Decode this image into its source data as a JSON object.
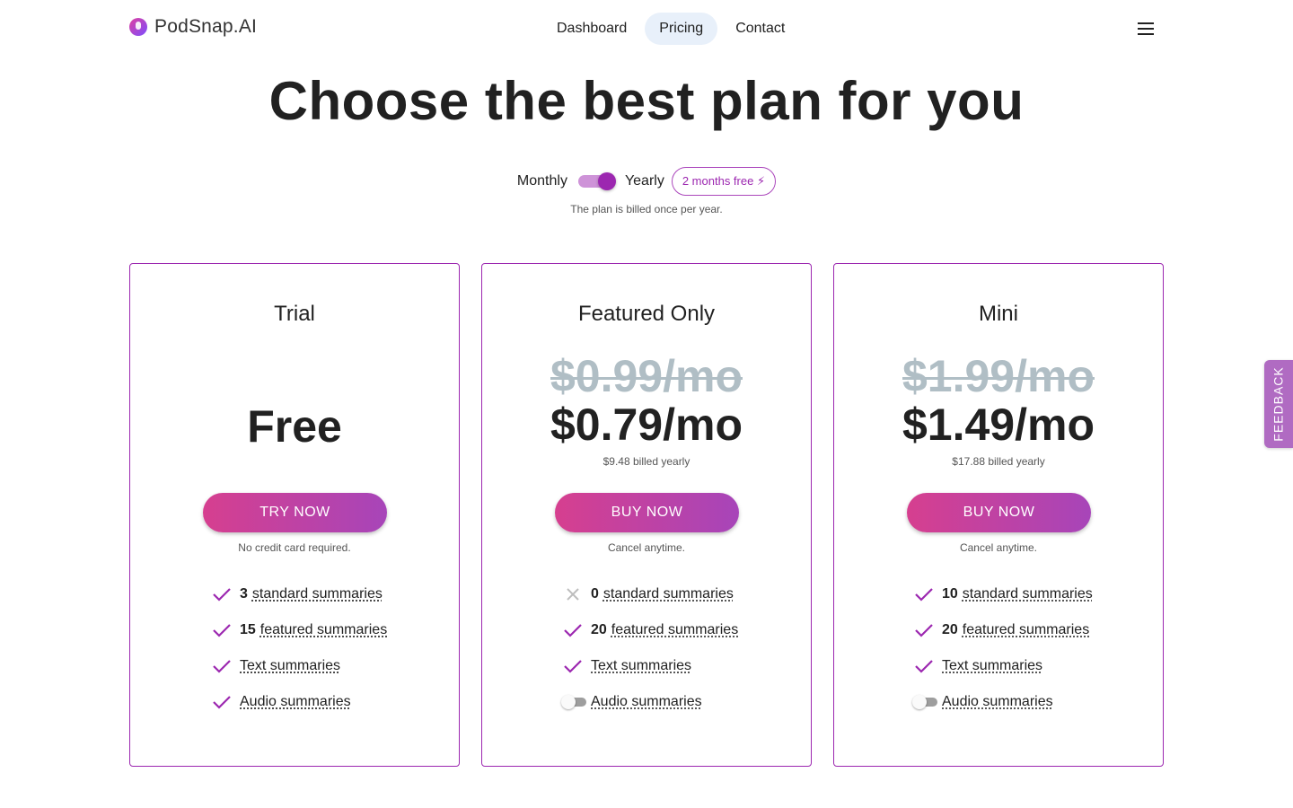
{
  "brand": {
    "name": "PodSnap.AI"
  },
  "nav": [
    {
      "label": "Dashboard",
      "active": false
    },
    {
      "label": "Pricing",
      "active": true
    },
    {
      "label": "Contact",
      "active": false
    }
  ],
  "hero": {
    "title": "Choose the best plan for you",
    "monthly_label": "Monthly",
    "yearly_label": "Yearly",
    "yearly_selected": true,
    "promo": "2 months free ⚡",
    "billing_note": "The plan is billed once per year."
  },
  "plans": [
    {
      "name": "Trial",
      "price": "Free",
      "cta": "TRY NOW",
      "cta_note": "No credit card required.",
      "features": [
        {
          "icon": "check-icon",
          "num": "3",
          "label": "standard summaries"
        },
        {
          "icon": "check-icon",
          "num": "15",
          "label": "featured summaries"
        },
        {
          "icon": "check-icon",
          "label": "Text summaries"
        },
        {
          "icon": "check-icon",
          "label": "Audio summaries"
        }
      ]
    },
    {
      "name": "Featured Only",
      "old_price": "$0.99/mo",
      "price": "$0.79/mo",
      "billed": "$9.48 billed yearly",
      "cta": "BUY NOW",
      "cta_note": "Cancel anytime.",
      "features": [
        {
          "icon": "cross-icon",
          "num": "0",
          "label": "standard summaries"
        },
        {
          "icon": "check-icon",
          "num": "20",
          "label": "featured summaries"
        },
        {
          "icon": "check-icon",
          "label": "Text summaries"
        },
        {
          "icon": "toggle-off-icon",
          "label": "Audio summaries"
        }
      ]
    },
    {
      "name": "Mini",
      "old_price": "$1.99/mo",
      "price": "$1.49/mo",
      "billed": "$17.88 billed yearly",
      "cta": "BUY NOW",
      "cta_note": "Cancel anytime.",
      "features": [
        {
          "icon": "check-icon",
          "num": "10",
          "label": "standard summaries"
        },
        {
          "icon": "check-icon",
          "num": "20",
          "label": "featured summaries"
        },
        {
          "icon": "check-icon",
          "label": "Text summaries"
        },
        {
          "icon": "toggle-off-icon",
          "label": "Audio summaries"
        }
      ]
    }
  ],
  "feedback": {
    "label": "FEEDBACK"
  },
  "colors": {
    "accent": "#9c27b0",
    "gradient_start": "#d63f8f",
    "gradient_end": "#a745b9",
    "old_price": "#b0bec5"
  }
}
